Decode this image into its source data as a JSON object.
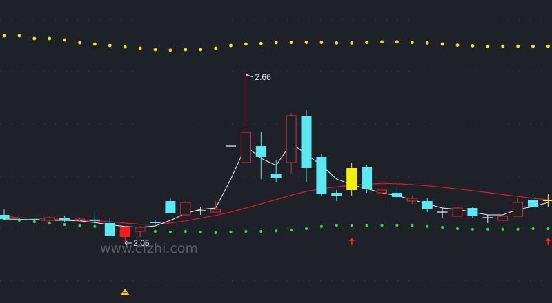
{
  "chart_data": {
    "type": "candlestick",
    "title": "",
    "xlabel": "",
    "ylabel": "",
    "ylim": [
      1.95,
      2.82
    ],
    "grid": true,
    "watermark": "www.cfzhi.com",
    "colors": {
      "background": "#1f2129",
      "up_candle": "#e0283c",
      "down_candle": "#5ce8f0",
      "highlight_candle": "#f5f00a",
      "red_filled_candle": "#ff1a1a",
      "ma_white": "#f2f2f2",
      "ma_red": "#d51a34",
      "upper_band": "#f2e41c",
      "lower_band": "#34d63c",
      "signal_arrow": "#ff2020",
      "signal_marker": "#f2c233"
    },
    "candles": [
      {
        "o": 2.15,
        "h": 2.17,
        "l": 2.13,
        "c": 2.135,
        "style": "down"
      },
      {
        "o": 2.135,
        "h": 2.14,
        "l": 2.13,
        "c": 2.13,
        "style": "down"
      },
      {
        "o": 2.13,
        "h": 2.14,
        "l": 2.125,
        "c": 2.135,
        "style": "down"
      },
      {
        "o": 2.13,
        "h": 2.145,
        "l": 2.125,
        "c": 2.14,
        "style": "up"
      },
      {
        "o": 2.14,
        "h": 2.145,
        "l": 2.125,
        "c": 2.13,
        "style": "down"
      },
      {
        "o": 2.13,
        "h": 2.14,
        "l": 2.125,
        "c": 2.135,
        "style": "up"
      },
      {
        "o": 2.133,
        "h": 2.16,
        "l": 2.11,
        "c": 2.128,
        "style": "down"
      },
      {
        "o": 2.12,
        "h": 2.14,
        "l": 2.07,
        "c": 2.075,
        "style": "down"
      },
      {
        "o": 2.105,
        "h": 2.11,
        "l": 2.05,
        "c": 2.07,
        "style": "redfill"
      },
      {
        "o": 2.09,
        "h": 2.11,
        "l": 2.07,
        "c": 2.105,
        "style": "up"
      },
      {
        "o": 2.125,
        "h": 2.13,
        "l": 2.115,
        "c": 2.12,
        "style": "down"
      },
      {
        "o": 2.2,
        "h": 2.21,
        "l": 2.18,
        "c": 2.155,
        "style": "down"
      },
      {
        "o": 2.15,
        "h": 2.2,
        "l": 2.15,
        "c": 2.195,
        "style": "up"
      },
      {
        "o": 2.165,
        "h": 2.18,
        "l": 2.15,
        "c": 2.165,
        "style": "cross"
      },
      {
        "o": 2.16,
        "h": 2.2,
        "l": 2.16,
        "c": 2.17,
        "style": "up"
      },
      {
        "o": 2.4,
        "h": 2.4,
        "l": 2.4,
        "c": 2.4,
        "style": "cross"
      },
      {
        "o": 2.34,
        "h": 2.66,
        "l": 2.34,
        "c": 2.45,
        "style": "up"
      },
      {
        "o": 2.4,
        "h": 2.45,
        "l": 2.28,
        "c": 2.36,
        "style": "down"
      },
      {
        "o": 2.3,
        "h": 2.35,
        "l": 2.27,
        "c": 2.285,
        "style": "down"
      },
      {
        "o": 2.34,
        "h": 2.52,
        "l": 2.3,
        "c": 2.51,
        "style": "up"
      },
      {
        "o": 2.51,
        "h": 2.53,
        "l": 2.27,
        "c": 2.32,
        "style": "down"
      },
      {
        "o": 2.36,
        "h": 2.37,
        "l": 2.22,
        "c": 2.225,
        "style": "down"
      },
      {
        "o": 2.23,
        "h": 2.24,
        "l": 2.2,
        "c": 2.22,
        "style": "down"
      },
      {
        "o": 2.32,
        "h": 2.34,
        "l": 2.22,
        "c": 2.24,
        "style": "highlight"
      },
      {
        "o": 2.325,
        "h": 2.33,
        "l": 2.23,
        "c": 2.245,
        "style": "down"
      },
      {
        "o": 2.23,
        "h": 2.27,
        "l": 2.2,
        "c": 2.24,
        "style": "up"
      },
      {
        "o": 2.23,
        "h": 2.25,
        "l": 2.21,
        "c": 2.215,
        "style": "down"
      },
      {
        "o": 2.2,
        "h": 2.22,
        "l": 2.19,
        "c": 2.21,
        "style": "up"
      },
      {
        "o": 2.2,
        "h": 2.21,
        "l": 2.16,
        "c": 2.17,
        "style": "down"
      },
      {
        "o": 2.16,
        "h": 2.175,
        "l": 2.14,
        "c": 2.16,
        "style": "cross"
      },
      {
        "o": 2.145,
        "h": 2.18,
        "l": 2.145,
        "c": 2.175,
        "style": "up"
      },
      {
        "o": 2.175,
        "h": 2.18,
        "l": 2.14,
        "c": 2.145,
        "style": "down"
      },
      {
        "o": 2.14,
        "h": 2.15,
        "l": 2.12,
        "c": 2.14,
        "style": "cross"
      },
      {
        "o": 2.13,
        "h": 2.15,
        "l": 2.13,
        "c": 2.145,
        "style": "up"
      },
      {
        "o": 2.145,
        "h": 2.21,
        "l": 2.145,
        "c": 2.195,
        "style": "up"
      },
      {
        "o": 2.205,
        "h": 2.215,
        "l": 2.18,
        "c": 2.18,
        "style": "down"
      },
      {
        "o": 2.2,
        "h": 2.225,
        "l": 2.18,
        "c": 2.205,
        "style": "highlight"
      }
    ],
    "ma_white": [
      2.135,
      2.134,
      2.132,
      2.13,
      2.13,
      2.128,
      2.122,
      2.114,
      2.108,
      2.105,
      2.11,
      2.13,
      2.155,
      2.17,
      2.175,
      2.28,
      2.4,
      2.355,
      2.33,
      2.41,
      2.37,
      2.33,
      2.28,
      2.26,
      2.245,
      2.23,
      2.22,
      2.205,
      2.19,
      2.175,
      2.17,
      2.16,
      2.15,
      2.15,
      2.17,
      2.18,
      2.195
    ],
    "ma_red": [
      2.145,
      2.14,
      2.138,
      2.135,
      2.133,
      2.13,
      2.128,
      2.125,
      2.12,
      2.116,
      2.116,
      2.12,
      2.128,
      2.138,
      2.148,
      2.16,
      2.175,
      2.19,
      2.205,
      2.222,
      2.235,
      2.245,
      2.252,
      2.258,
      2.262,
      2.264,
      2.263,
      2.26,
      2.256,
      2.25,
      2.244,
      2.238,
      2.231,
      2.224,
      2.217,
      2.21,
      2.205
    ],
    "upper_band": [
      2.8,
      2.8,
      2.79,
      2.79,
      2.785,
      2.775,
      2.77,
      2.765,
      2.76,
      2.755,
      2.75,
      2.748,
      2.75,
      2.75,
      2.755,
      2.765,
      2.77,
      2.772,
      2.775,
      2.776,
      2.776,
      2.776,
      2.774,
      2.774,
      2.776,
      2.778,
      2.778,
      2.776,
      2.774,
      2.77,
      2.766,
      2.764,
      2.762,
      2.762,
      2.762,
      2.762,
      2.762
    ],
    "lower_band": [
      2.135,
      2.13,
      2.125,
      2.12,
      2.115,
      2.11,
      2.108,
      2.1,
      2.098,
      2.095,
      2.09,
      2.088,
      2.09,
      2.088,
      2.085,
      2.088,
      2.09,
      2.09,
      2.092,
      2.095,
      2.1,
      2.108,
      2.112,
      2.112,
      2.112,
      2.112,
      2.112,
      2.112,
      2.108,
      2.105,
      2.1,
      2.098,
      2.098,
      2.098,
      2.098,
      2.1,
      2.1
    ],
    "annotations": [
      {
        "text": "2.66",
        "candle_index": 16,
        "kind": "high"
      },
      {
        "text": "2.05",
        "candle_index": 8,
        "kind": "low"
      }
    ],
    "signals": [
      {
        "candle_index": 23,
        "kind": "buy-arrow"
      },
      {
        "candle_index": 36,
        "kind": "buy-arrow"
      },
      {
        "candle_index": 8,
        "kind": "marker"
      }
    ]
  }
}
